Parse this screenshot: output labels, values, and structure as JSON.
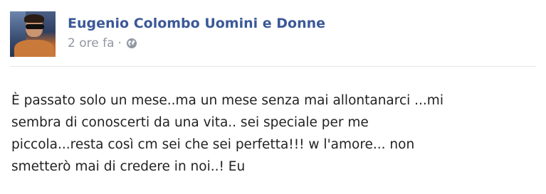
{
  "post": {
    "author_name": "Eugenio Colombo Uomini e Donne",
    "timestamp": "2 ore fa",
    "separator": "·",
    "privacy_icon": "globe-icon",
    "message_lines": [
      "È passato solo un mese..ma un mese senza mai allontanarci ...mi",
      "sembra di conoscerti da una vita.. sei speciale per me",
      "piccola...resta così cm sei che sei perfetta!!! w l'amore... non",
      "smetterò mai di credere in noi..! Eu"
    ]
  },
  "colors": {
    "author_link": "#3b5998",
    "meta_text": "#9197a3",
    "body_text": "#222222",
    "divider": "#e5e5e5"
  }
}
